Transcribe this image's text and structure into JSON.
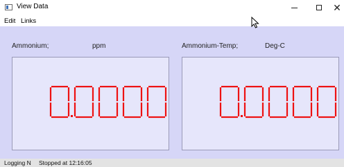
{
  "window": {
    "title": "View Data"
  },
  "menu": {
    "items": [
      "Edit",
      "Links"
    ]
  },
  "readouts": [
    {
      "name": "Ammonium;",
      "unit": "ppm",
      "value": "0.0000"
    },
    {
      "name": "Ammonium-Temp;",
      "unit": "Deg-C",
      "value": "0.0000"
    }
  ],
  "status": {
    "logging": "Logging N",
    "state": "Stopped at 12:16:05"
  },
  "colors": {
    "display_background": "#d6d6f7",
    "panel": "#e6e6fb",
    "segment_digit": "#ee1111"
  },
  "icons": {
    "app": "window-app-icon",
    "cursor": "mouse-pointer-icon"
  }
}
